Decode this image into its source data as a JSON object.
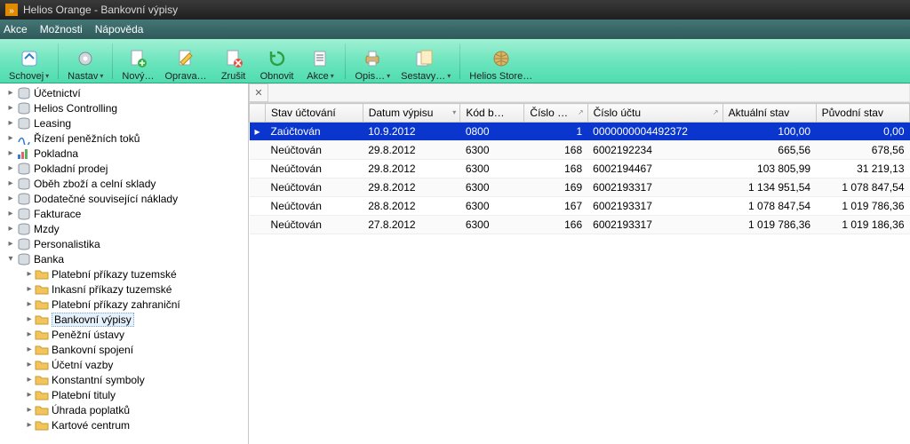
{
  "window": {
    "title": "Helios Orange - Bankovní výpisy"
  },
  "menubar": {
    "items": [
      "Akce",
      "Možnosti",
      "Nápověda"
    ]
  },
  "toolbar": {
    "items": [
      {
        "id": "schovej",
        "label": "Schovej"
      },
      {
        "id": "nastav",
        "label": "Nastav"
      },
      {
        "id": "novy",
        "label": "Nový…"
      },
      {
        "id": "oprava",
        "label": "Oprava…"
      },
      {
        "id": "zrusit",
        "label": "Zrušit"
      },
      {
        "id": "obnovit",
        "label": "Obnovit"
      },
      {
        "id": "akce",
        "label": "Akce"
      },
      {
        "id": "opis",
        "label": "Opis…"
      },
      {
        "id": "sestavy",
        "label": "Sestavy…"
      },
      {
        "id": "heliosstore",
        "label": "Helios Store…"
      }
    ]
  },
  "tree": {
    "top": [
      {
        "label": "Účetnictví",
        "icon": "db"
      },
      {
        "label": "Helios Controlling",
        "icon": "db"
      },
      {
        "label": "Leasing",
        "icon": "db"
      },
      {
        "label": "Řízení peněžních toků",
        "icon": "flow"
      },
      {
        "label": "Pokladna",
        "icon": "bars"
      },
      {
        "label": "Pokladní prodej",
        "icon": "db"
      },
      {
        "label": "Oběh zboží a celní sklady",
        "icon": "db"
      },
      {
        "label": "Dodatečné související náklady",
        "icon": "db"
      },
      {
        "label": "Fakturace",
        "icon": "db"
      },
      {
        "label": "Mzdy",
        "icon": "db"
      },
      {
        "label": "Personalistika",
        "icon": "db"
      },
      {
        "label": "Banka",
        "icon": "db",
        "expanded": true,
        "children": [
          {
            "label": "Platební příkazy tuzemské"
          },
          {
            "label": "Inkasní příkazy tuzemské"
          },
          {
            "label": "Platební příkazy zahraniční"
          },
          {
            "label": "Bankovní výpisy",
            "selected": true
          },
          {
            "label": "Peněžní ústavy"
          },
          {
            "label": "Bankovní spojení"
          },
          {
            "label": "Účetní vazby"
          },
          {
            "label": "Konstantní symboly"
          },
          {
            "label": "Platební tituly"
          },
          {
            "label": "Úhrada poplatků"
          },
          {
            "label": "Kartové centrum"
          }
        ]
      }
    ]
  },
  "grid": {
    "columns": [
      "Stav účtování",
      "Datum výpisu",
      "Kód b…",
      "Číslo …",
      "Číslo účtu",
      "Aktuální stav",
      "Původní stav"
    ],
    "rows": [
      {
        "sel": true,
        "ptr": "▸",
        "c": [
          "Zaúčtován",
          "10.9.2012",
          "0800",
          "1",
          "0000000004492372",
          "100,00",
          "0,00"
        ]
      },
      {
        "c": [
          "Neúčtován",
          "29.8.2012",
          "6300",
          "168",
          "6002192234",
          "665,56",
          "678,56"
        ]
      },
      {
        "c": [
          "Neúčtován",
          "29.8.2012",
          "6300",
          "168",
          "6002194467",
          "103 805,99",
          "31 219,13"
        ]
      },
      {
        "c": [
          "Neúčtován",
          "29.8.2012",
          "6300",
          "169",
          "6002193317",
          "1 134 951,54",
          "1 078 847,54"
        ]
      },
      {
        "c": [
          "Neúčtován",
          "28.8.2012",
          "6300",
          "167",
          "6002193317",
          "1 078 847,54",
          "1 019 786,36"
        ]
      },
      {
        "c": [
          "Neúčtován",
          "27.8.2012",
          "6300",
          "166",
          "6002193317",
          "1 019 786,36",
          "1 019 186,36"
        ]
      }
    ]
  }
}
